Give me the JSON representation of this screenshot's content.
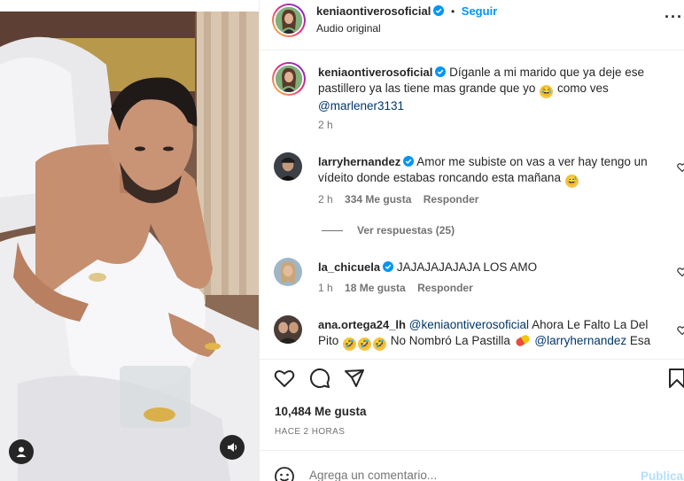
{
  "header": {
    "username": "keniaontiverosoficial",
    "separator": "•",
    "follow_label": "Seguir",
    "audio_label": "Audio original",
    "more_label": "···"
  },
  "caption": {
    "username": "keniaontiverosoficial",
    "line1": "Díganle a mi marido que ya deje ese",
    "line2a": "pastillero ya las tiene mas grande que yo",
    "line2b": "como ves",
    "mention": "@marlener3131",
    "time": "2 h"
  },
  "comments": [
    {
      "username": "larryhernandez",
      "line1": "Amor me subiste on vas a ver hay tengo un",
      "line2": "vídeito donde estabas roncando esta mañana",
      "time": "2 h",
      "likes": "334 Me gusta",
      "reply": "Responder",
      "view_replies": "Ver respuestas (25)"
    },
    {
      "username": "la_chicuela",
      "line1": "JAJAJAJAJAJA LOS AMO",
      "time": "1 h",
      "likes": "18 Me gusta",
      "reply": "Responder"
    },
    {
      "username": "ana.ortega24_lh",
      "mention1": "@keniaontiverosoficial",
      "line1": "Ahora Le Falto La Del",
      "line2a": "Pito",
      "line2b": "No Nombró La Pastilla",
      "mention2": "@larryhernandez",
      "line2c": "Esa"
    }
  ],
  "post": {
    "likes": "10,484 Me gusta",
    "time_ago": "HACE 2 HORAS"
  },
  "composer": {
    "placeholder": "Agrega un comentario...",
    "publish_label": "Publicar"
  },
  "colors": {
    "accent": "#0095f6",
    "mention": "#00376b",
    "muted": "#737373",
    "verified": "#0095f6"
  }
}
